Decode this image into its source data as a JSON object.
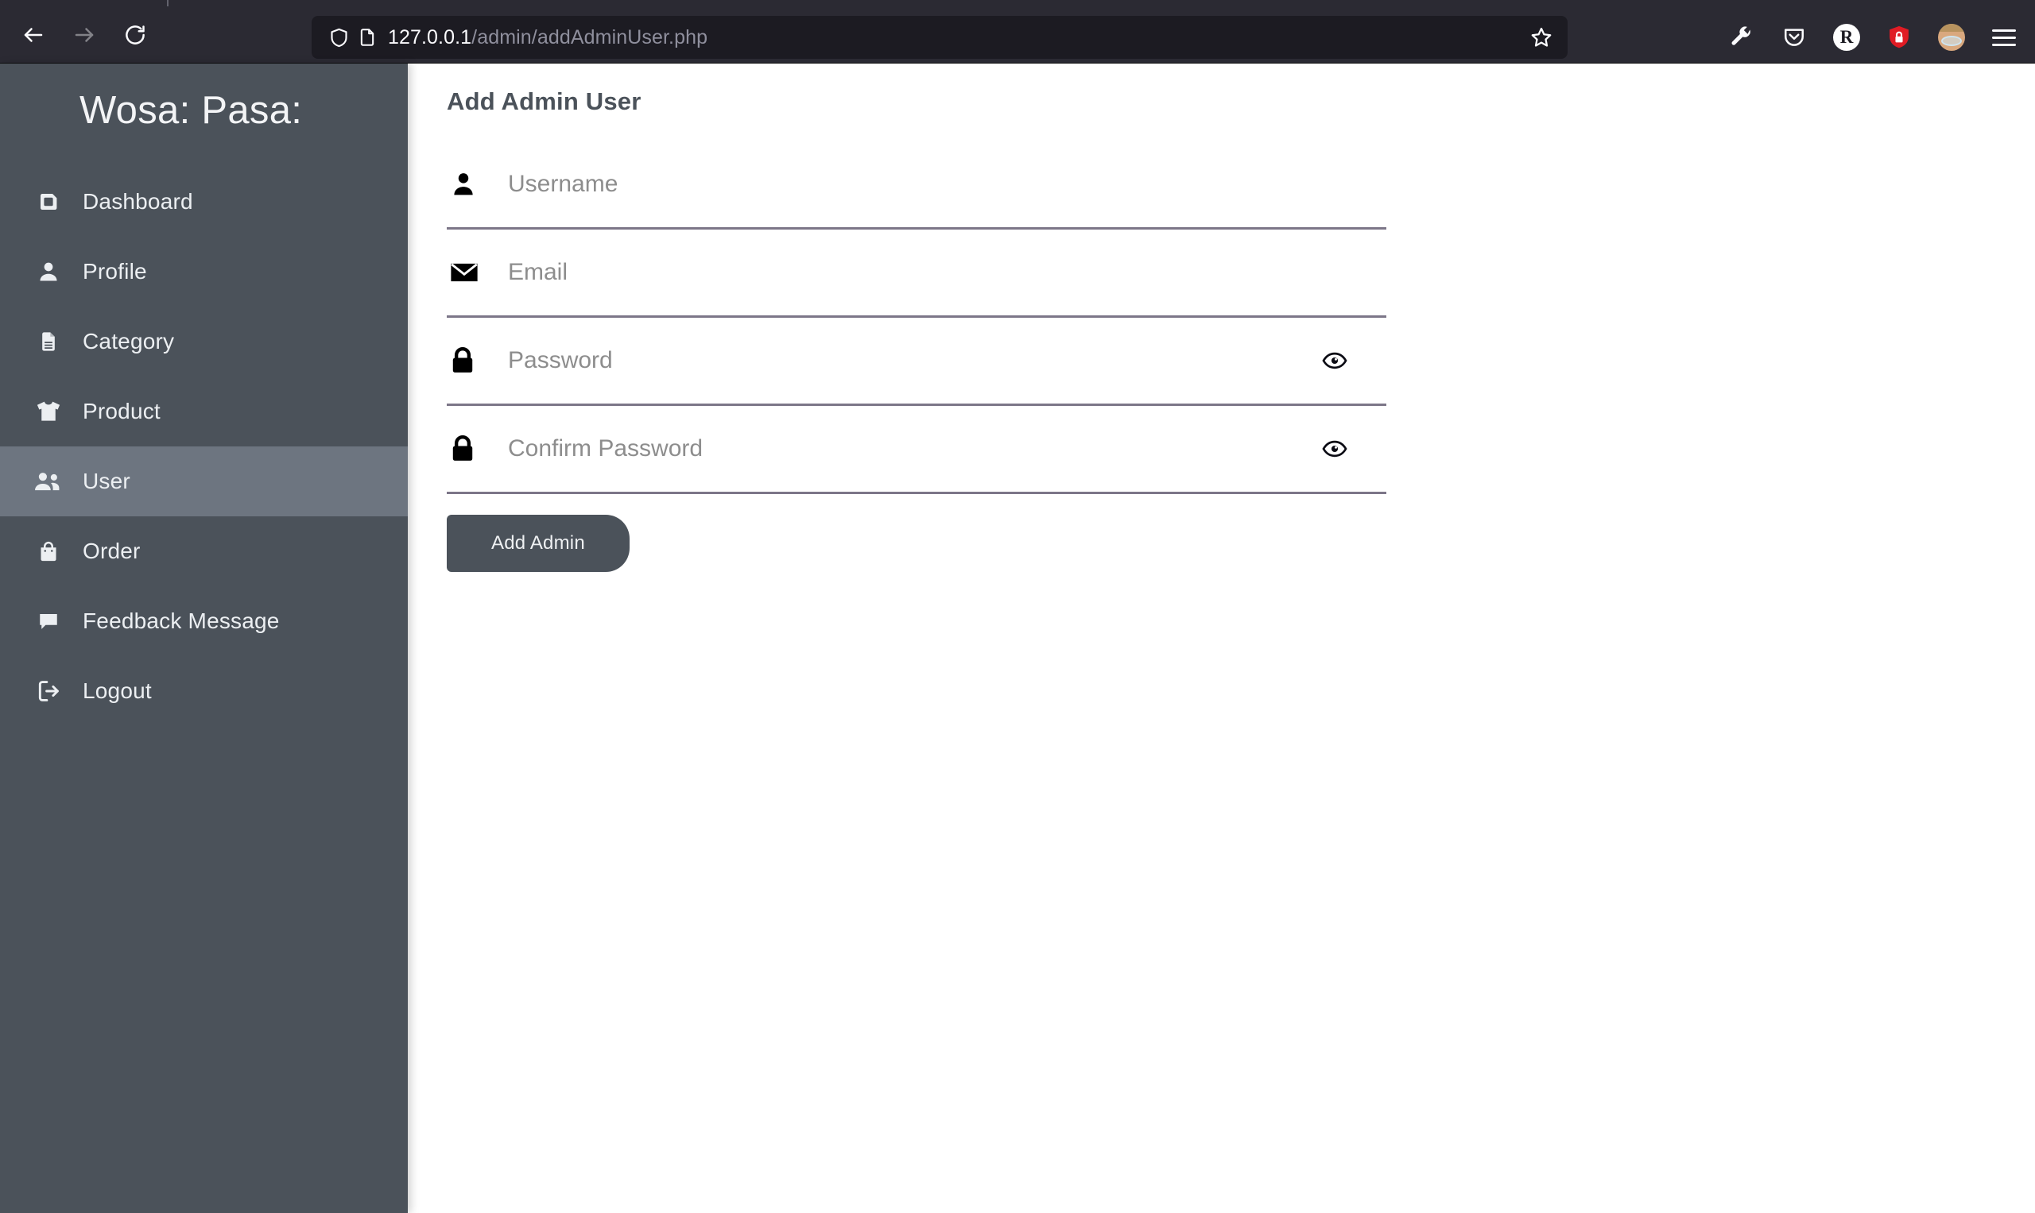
{
  "browser": {
    "back_label": "Back",
    "forward_label": "Forward",
    "reload_label": "Reload",
    "shield_label": "Tracking Protection",
    "page_icon_label": "Page info",
    "url_host": "127.0.0.1",
    "url_path": "/admin/addAdminUser.php",
    "url_full": "127.0.0.1/admin/addAdminUser.php",
    "bookmark_label": "Bookmark this page",
    "toolbar_icons": [
      {
        "name": "wrench-icon",
        "label": "Developer tools"
      },
      {
        "name": "pocket-icon",
        "label": "Save to Pocket"
      },
      {
        "name": "r-extension-icon",
        "label": "R",
        "text": "R"
      },
      {
        "name": "shield-lock-icon",
        "label": "Password manager",
        "color": "#e01b24"
      },
      {
        "name": "avatar-icon",
        "label": "Account"
      },
      {
        "name": "hamburger-menu-icon",
        "label": "Open application menu"
      }
    ]
  },
  "sidebar": {
    "brand": "Wosa: Pasa:",
    "background_color": "#4b525a",
    "active_color": "#6d7580",
    "items": [
      {
        "label": "Dashboard",
        "icon": "dashboard-icon",
        "active": false
      },
      {
        "label": "Profile",
        "icon": "user-icon",
        "active": false
      },
      {
        "label": "Category",
        "icon": "file-lines-icon",
        "active": false
      },
      {
        "label": "Product",
        "icon": "shirt-icon",
        "active": false
      },
      {
        "label": "User",
        "icon": "users-icon",
        "active": true
      },
      {
        "label": "Order",
        "icon": "bag-shopping-icon",
        "active": false
      },
      {
        "label": "Feedback Message",
        "icon": "comment-icon",
        "active": false
      },
      {
        "label": "Logout",
        "icon": "sign-out-icon",
        "active": false
      }
    ]
  },
  "main": {
    "title": "Add Admin User",
    "fields": [
      {
        "name": "username",
        "icon": "user-icon",
        "placeholder": "Username",
        "value": "",
        "type": "text",
        "has_toggle": false
      },
      {
        "name": "email",
        "icon": "envelope-icon",
        "placeholder": "Email",
        "value": "",
        "type": "text",
        "has_toggle": false
      },
      {
        "name": "password",
        "icon": "lock-icon",
        "placeholder": "Password",
        "value": "",
        "type": "password",
        "has_toggle": true,
        "toggle_icon": "eye-icon"
      },
      {
        "name": "confirm-password",
        "icon": "lock-icon",
        "placeholder": "Confirm Password",
        "value": "",
        "type": "password",
        "has_toggle": true,
        "toggle_icon": "eye-icon"
      }
    ],
    "submit_label": "Add Admin",
    "submit_color": "#4b525a",
    "underline_color": "#7c7688"
  }
}
